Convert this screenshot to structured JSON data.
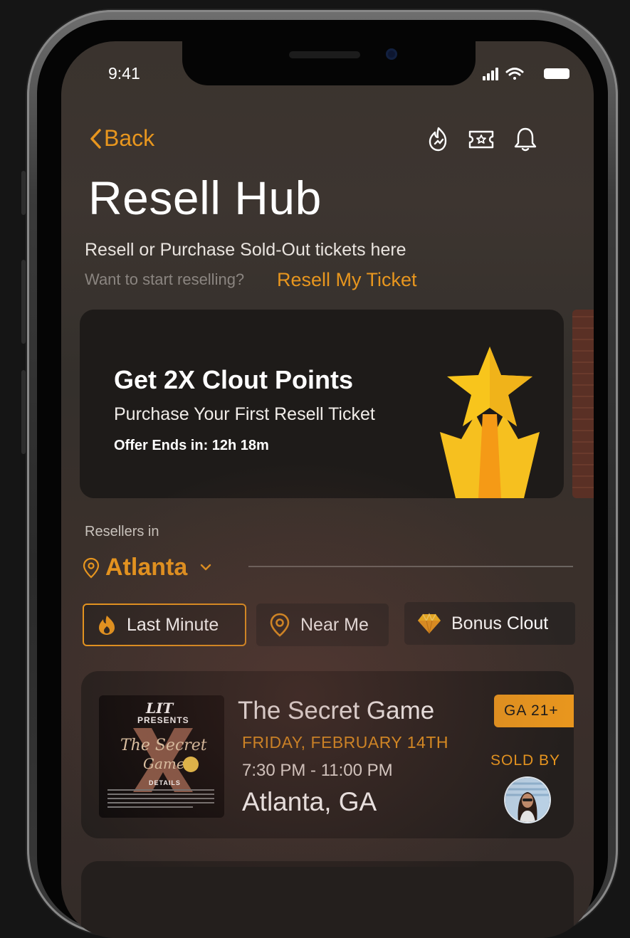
{
  "status_bar": {
    "time": "9:41"
  },
  "header": {
    "back_label": "Back",
    "icons": [
      "clout-flame-icon",
      "ticket-icon",
      "bell-icon"
    ],
    "title": "Resell Hub",
    "subtitle": "Resell or Purchase Sold-Out tickets here",
    "prompt": "Want to start reselling?",
    "link_label": "Resell My Ticket"
  },
  "promo": {
    "title": "Get 2X Clout Points",
    "subtitle": "Purchase Your First Resell Ticket",
    "offer": "Offer Ends in: 12h 18m"
  },
  "location": {
    "label": "Resellers in",
    "city": "Atlanta"
  },
  "filters": [
    {
      "label": "Last Minute",
      "icon": "flame-icon",
      "active": true
    },
    {
      "label": "Near Me",
      "icon": "location-pin-icon",
      "active": false
    },
    {
      "label": "Bonus Clout",
      "icon": "diamond-icon",
      "active": false
    }
  ],
  "event": {
    "name": "The Secret Game",
    "date": "FRIDAY, FEBRUARY 14TH",
    "time": "7:30 PM - 11:00 PM",
    "city": "Atlanta, GA",
    "badge": "GA 21+",
    "sold_by": "SOLD BY",
    "thumb": {
      "brand": "LIT",
      "presents": "PRESENTS",
      "line1": "The Secret",
      "line2": "Game",
      "details": "DETAILS"
    }
  },
  "colors": {
    "accent": "#e8961e",
    "background": "#3a332e",
    "card": "#241f1d"
  }
}
